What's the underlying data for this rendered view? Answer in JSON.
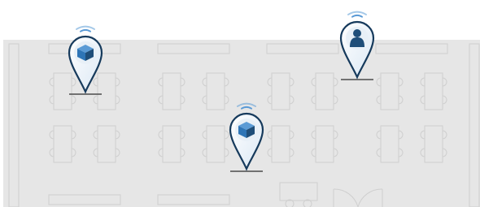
{
  "floorplan": {
    "colors": {
      "floor": "#e6e6e6",
      "line": "#cfcfcf",
      "wall": "#d4d4d4",
      "pin_stroke": "#163a5c",
      "pin_fill": "#ffffff",
      "pin_inner": "#e8f0f7",
      "icon_dark": "#1f4e79",
      "icon_mid": "#2e75b6",
      "icon_light": "#5b9bd5",
      "signal": "#5a9ad6",
      "ground": "#4a4a4a"
    }
  },
  "markers": [
    {
      "type": "asset",
      "icon": "cube-icon",
      "label": ""
    },
    {
      "type": "asset",
      "icon": "cube-icon",
      "label": ""
    },
    {
      "type": "person",
      "icon": "person-icon",
      "label": ""
    }
  ]
}
